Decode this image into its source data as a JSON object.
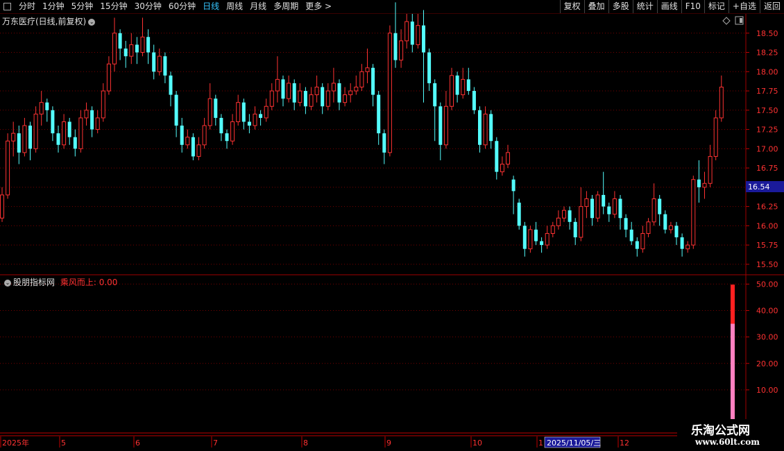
{
  "toolbar": {
    "periods": [
      "分时",
      "1分钟",
      "5分钟",
      "15分钟",
      "30分钟",
      "60分钟",
      "日线",
      "周线",
      "月线",
      "多周期",
      "更多 >"
    ],
    "active_period": "日线",
    "right_buttons": [
      "复权",
      "叠加",
      "多股",
      "统计",
      "画线",
      "F10",
      "标记",
      "+自选",
      "返回"
    ]
  },
  "main_panel": {
    "title": "万东医疗(日线,前复权)",
    "price_tag": "16.54",
    "price_levels": [
      "18.50",
      "18.25",
      "18.00",
      "17.75",
      "17.50",
      "17.25",
      "17.00",
      "16.75",
      "16.50",
      "16.25",
      "16.00",
      "15.75",
      "15.50"
    ]
  },
  "indicator_panel": {
    "source": "股朋指标网",
    "indicator_label": "乘风而上: 0.00",
    "levels": [
      "50.00",
      "40.00",
      "30.00",
      "20.00",
      "10.00"
    ]
  },
  "time_axis": {
    "labels": [
      "2025年",
      "5",
      "6",
      "7",
      "8",
      "9",
      "10",
      "1",
      "12"
    ],
    "cursor_date": "2025/11/05/三"
  },
  "watermark": {
    "title": "乐淘公式网",
    "url": "www.60lt.com"
  },
  "colors": {
    "up": "#ff3232",
    "down": "#54ffff",
    "grid": "#7a0000",
    "axis_text": "#ff3232",
    "pink_bar": "#ff80c0"
  },
  "chart_data": [
    {
      "type": "candlestick",
      "title": "万东医疗(日线,前复权)",
      "y_range": [
        15.4,
        18.75
      ],
      "last_price": 16.54,
      "series": [
        {
          "name": "",
          "values": [
            [
              16.1,
              16.4,
              16.05,
              16.5
            ],
            [
              16.4,
              17.1,
              16.35,
              17.2
            ],
            [
              17.1,
              17.2,
              16.9,
              17.35
            ],
            [
              17.2,
              16.95,
              16.8,
              17.3
            ],
            [
              16.95,
              17.3,
              16.9,
              17.4
            ],
            [
              17.3,
              17.0,
              16.85,
              17.35
            ],
            [
              17.0,
              17.45,
              16.95,
              17.55
            ],
            [
              17.45,
              17.6,
              17.3,
              17.75
            ],
            [
              17.6,
              17.5,
              17.35,
              17.65
            ],
            [
              17.5,
              17.2,
              17.1,
              17.55
            ],
            [
              17.2,
              17.05,
              16.95,
              17.3
            ],
            [
              17.05,
              17.35,
              17.0,
              17.45
            ],
            [
              17.35,
              17.15,
              17.05,
              17.4
            ],
            [
              17.15,
              17.0,
              16.9,
              17.25
            ],
            [
              17.0,
              17.4,
              16.95,
              17.5
            ],
            [
              17.4,
              17.5,
              17.3,
              17.6
            ],
            [
              17.5,
              17.25,
              17.15,
              17.55
            ],
            [
              17.25,
              17.4,
              17.2,
              17.5
            ],
            [
              17.4,
              17.75,
              17.35,
              17.85
            ],
            [
              17.75,
              18.1,
              17.7,
              18.2
            ],
            [
              18.1,
              18.5,
              18.0,
              18.7
            ],
            [
              18.5,
              18.3,
              18.15,
              18.55
            ],
            [
              18.3,
              18.2,
              18.05,
              18.4
            ],
            [
              18.2,
              18.35,
              18.1,
              18.5
            ],
            [
              18.35,
              18.25,
              18.1,
              18.45
            ],
            [
              18.25,
              18.45,
              18.2,
              18.7
            ],
            [
              18.45,
              18.25,
              18.1,
              18.55
            ],
            [
              18.25,
              18.0,
              17.9,
              18.35
            ],
            [
              18.0,
              18.2,
              17.95,
              18.3
            ],
            [
              18.2,
              17.95,
              17.85,
              18.25
            ],
            [
              17.95,
              17.7,
              17.55,
              18.0
            ],
            [
              17.7,
              17.3,
              17.15,
              17.75
            ],
            [
              17.3,
              17.05,
              16.95,
              17.4
            ],
            [
              17.05,
              17.15,
              17.0,
              17.25
            ],
            [
              17.15,
              16.9,
              16.85,
              17.2
            ],
            [
              16.9,
              17.05,
              16.85,
              17.15
            ],
            [
              17.05,
              17.3,
              17.0,
              17.4
            ],
            [
              17.3,
              17.65,
              17.25,
              17.85
            ],
            [
              17.65,
              17.4,
              17.3,
              17.7
            ],
            [
              17.4,
              17.2,
              17.1,
              17.45
            ],
            [
              17.2,
              17.1,
              17.0,
              17.25
            ],
            [
              17.1,
              17.35,
              17.05,
              17.45
            ],
            [
              17.35,
              17.6,
              17.3,
              17.7
            ],
            [
              17.6,
              17.35,
              17.25,
              17.65
            ],
            [
              17.35,
              17.3,
              17.2,
              17.45
            ],
            [
              17.3,
              17.45,
              17.25,
              17.55
            ],
            [
              17.45,
              17.4,
              17.3,
              17.5
            ],
            [
              17.4,
              17.55,
              17.35,
              17.65
            ],
            [
              17.55,
              17.75,
              17.5,
              17.85
            ],
            [
              17.75,
              17.9,
              17.6,
              18.2
            ],
            [
              17.9,
              17.65,
              17.55,
              17.95
            ],
            [
              17.65,
              17.85,
              17.6,
              17.95
            ],
            [
              17.85,
              17.6,
              17.5,
              17.9
            ],
            [
              17.6,
              17.75,
              17.55,
              17.85
            ],
            [
              17.75,
              17.55,
              17.45,
              17.8
            ],
            [
              17.55,
              17.7,
              17.5,
              17.8
            ],
            [
              17.7,
              17.8,
              17.6,
              17.95
            ],
            [
              17.8,
              17.55,
              17.45,
              17.85
            ],
            [
              17.55,
              17.75,
              17.5,
              17.85
            ],
            [
              17.75,
              17.85,
              17.6,
              18.05
            ],
            [
              17.85,
              17.6,
              17.5,
              17.9
            ],
            [
              17.6,
              17.7,
              17.55,
              17.8
            ],
            [
              17.7,
              17.75,
              17.6,
              17.85
            ],
            [
              17.75,
              17.8,
              17.7,
              17.95
            ],
            [
              17.8,
              18.0,
              17.75,
              18.1
            ],
            [
              18.0,
              18.05,
              17.85,
              18.3
            ],
            [
              18.05,
              17.7,
              17.55,
              18.1
            ],
            [
              17.7,
              17.2,
              17.05,
              17.75
            ],
            [
              17.2,
              16.95,
              16.8,
              17.25
            ],
            [
              16.95,
              18.5,
              16.9,
              18.6
            ],
            [
              18.5,
              18.15,
              18.05,
              18.9
            ],
            [
              18.15,
              18.4,
              18.05,
              18.55
            ],
            [
              18.4,
              18.65,
              18.3,
              18.75
            ],
            [
              18.65,
              18.35,
              18.25,
              18.75
            ],
            [
              18.35,
              18.6,
              18.3,
              18.75
            ],
            [
              18.6,
              18.25,
              17.6,
              18.8
            ],
            [
              18.25,
              17.85,
              17.75,
              18.3
            ],
            [
              17.85,
              17.55,
              17.1,
              17.9
            ],
            [
              17.55,
              17.05,
              16.85,
              17.6
            ],
            [
              17.05,
              17.55,
              17.0,
              17.75
            ],
            [
              17.55,
              17.95,
              17.5,
              18.05
            ],
            [
              17.95,
              17.7,
              17.6,
              18.0
            ],
            [
              17.7,
              17.9,
              17.65,
              18.05
            ],
            [
              17.9,
              17.75,
              17.7,
              18.05
            ],
            [
              17.75,
              17.5,
              17.45,
              17.8
            ],
            [
              17.5,
              17.05,
              16.95,
              17.55
            ],
            [
              17.05,
              17.45,
              17.0,
              17.55
            ],
            [
              17.45,
              17.1,
              17.0,
              17.5
            ],
            [
              17.1,
              16.7,
              16.6,
              17.15
            ],
            [
              16.7,
              16.8,
              16.65,
              16.9
            ],
            [
              16.8,
              16.95,
              16.75,
              17.05
            ],
            [
              16.6,
              16.45,
              16.15,
              16.65
            ],
            [
              16.3,
              16.0,
              15.95,
              16.35
            ],
            [
              16.0,
              15.7,
              15.6,
              16.05
            ],
            [
              15.7,
              15.95,
              15.65,
              16.0
            ],
            [
              15.95,
              15.8,
              15.75,
              16.05
            ],
            [
              15.8,
              15.75,
              15.65,
              15.85
            ],
            [
              15.75,
              15.9,
              15.7,
              16.0
            ],
            [
              15.9,
              16.0,
              15.85,
              16.05
            ],
            [
              16.0,
              16.1,
              15.95,
              16.2
            ],
            [
              16.1,
              16.2,
              16.05,
              16.25
            ],
            [
              16.2,
              16.05,
              15.95,
              16.25
            ],
            [
              16.05,
              15.85,
              15.75,
              16.1
            ],
            [
              15.85,
              16.25,
              15.8,
              16.5
            ],
            [
              16.25,
              16.35,
              16.1,
              16.45
            ],
            [
              16.35,
              16.1,
              16.0,
              16.4
            ],
            [
              16.1,
              16.4,
              16.05,
              16.45
            ],
            [
              16.4,
              16.25,
              16.15,
              16.7
            ],
            [
              16.25,
              16.15,
              16.05,
              16.3
            ],
            [
              16.15,
              16.35,
              16.1,
              16.45
            ],
            [
              16.35,
              16.1,
              15.95,
              16.4
            ],
            [
              16.1,
              15.95,
              15.85,
              16.15
            ],
            [
              15.95,
              15.8,
              15.75,
              16.05
            ],
            [
              15.8,
              15.7,
              15.6,
              15.85
            ],
            [
              15.7,
              15.9,
              15.65,
              16.0
            ],
            [
              15.9,
              16.05,
              15.85,
              16.1
            ],
            [
              16.05,
              16.35,
              16.0,
              16.55
            ],
            [
              16.35,
              16.15,
              16.0,
              16.4
            ],
            [
              16.15,
              15.95,
              15.9,
              16.2
            ],
            [
              15.95,
              16.0,
              15.9,
              16.05
            ],
            [
              16.0,
              15.85,
              15.75,
              16.05
            ],
            [
              15.85,
              15.7,
              15.6,
              15.9
            ],
            [
              15.7,
              15.75,
              15.65,
              15.8
            ],
            [
              15.75,
              16.6,
              15.7,
              16.65
            ],
            [
              16.6,
              16.5,
              16.3,
              16.85
            ],
            [
              16.5,
              16.55,
              16.35,
              16.7
            ],
            [
              16.55,
              16.9,
              16.5,
              17.05
            ],
            [
              16.9,
              17.4,
              16.85,
              17.5
            ],
            [
              17.4,
              17.8,
              17.35,
              17.95
            ]
          ]
        }
      ]
    },
    {
      "type": "bar",
      "title": "乘风而上",
      "y_range": [
        0,
        53
      ],
      "series": [
        {
          "name": "",
          "values": [
            {
              "index": 130,
              "value": 49.8,
              "color": "#ff2020"
            }
          ]
        },
        {
          "name": "",
          "values": [
            {
              "index": 130,
              "value": 35.0,
              "color": "#ff80c0"
            }
          ]
        }
      ]
    }
  ]
}
